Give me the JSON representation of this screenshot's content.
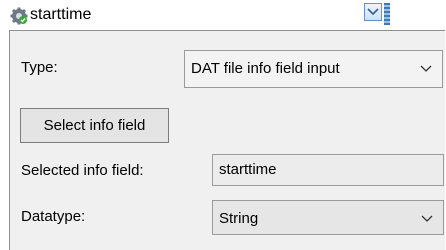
{
  "header": {
    "title": "starttime",
    "icon": "gear-icon",
    "collapse_icon": "chevron-down-icon"
  },
  "form": {
    "type_label": "Type:",
    "type_value": "DAT file info field input",
    "select_button_label": "Select info field",
    "selected_label": "Selected info field:",
    "selected_value": "starttime",
    "datatype_label": "Datatype:",
    "datatype_value": "String"
  },
  "colors": {
    "panel_background": "#f0f0f0",
    "accent": "#3d7ab8"
  }
}
